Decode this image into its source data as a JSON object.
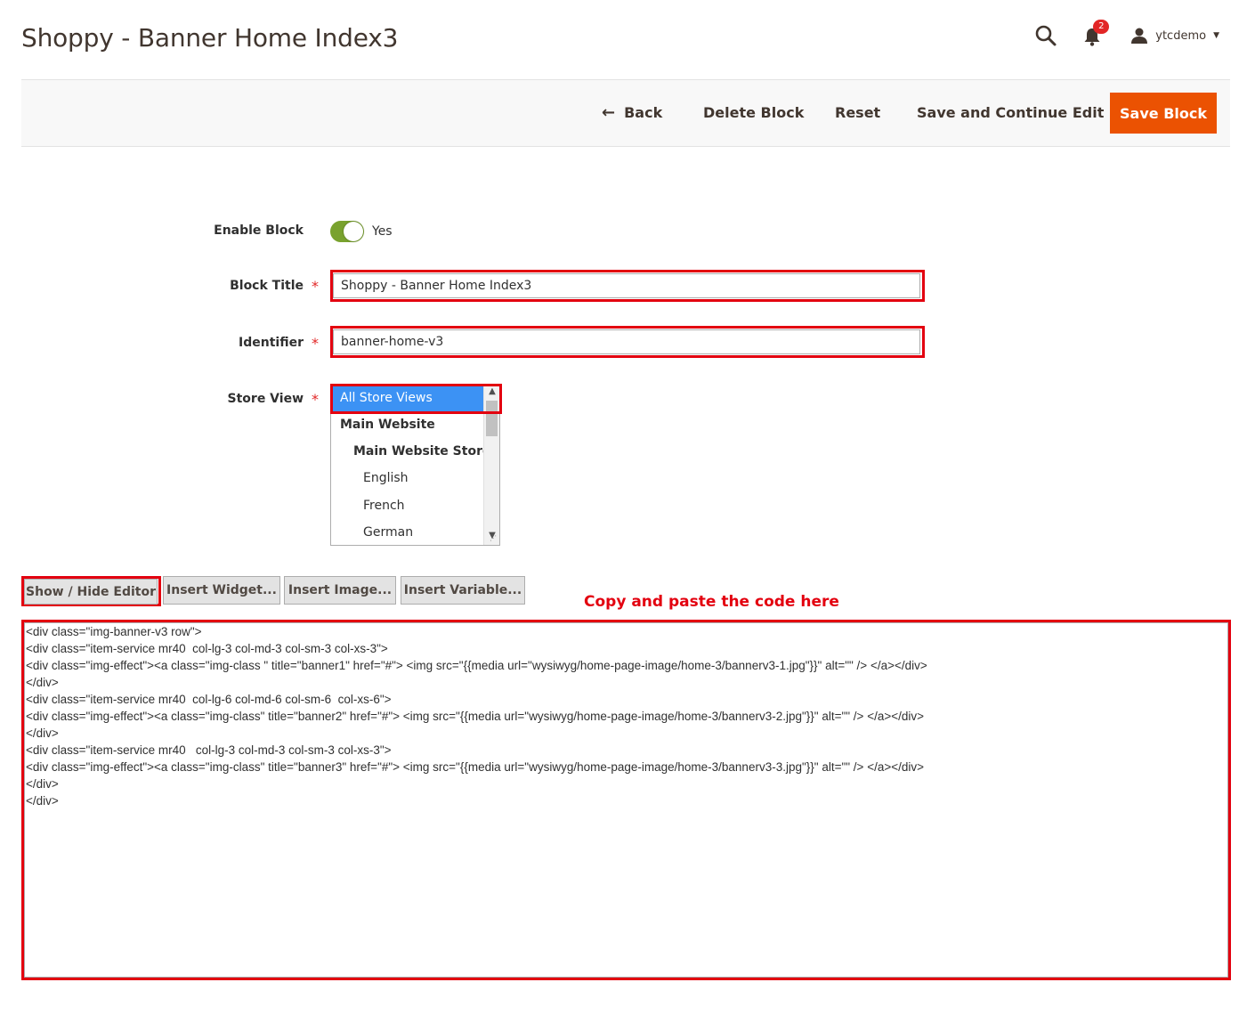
{
  "header": {
    "title": "Shoppy - Banner Home Index3",
    "notification_count": "2",
    "username": "ytcdemo"
  },
  "actions": {
    "back": "Back",
    "delete": "Delete Block",
    "reset": "Reset",
    "save_continue": "Save and Continue Edit",
    "save": "Save Block"
  },
  "form": {
    "enable_label": "Enable Block",
    "enable_value": "Yes",
    "title_label": "Block Title",
    "title_value": "Shoppy - Banner Home Index3",
    "identifier_label": "Identifier",
    "identifier_value": "banner-home-v3",
    "store_label": "Store View",
    "required_mark": "*",
    "store_options": [
      {
        "label": "All Store Views",
        "selected": true
      },
      {
        "label": "Main Website",
        "group": true
      },
      {
        "label": "Main Website Store",
        "group": true
      },
      {
        "label": "English"
      },
      {
        "label": "French"
      },
      {
        "label": "German"
      }
    ]
  },
  "editor": {
    "show_hide": "Show / Hide Editor",
    "insert_widget": "Insert Widget...",
    "insert_image": "Insert Image...",
    "insert_variable": "Insert Variable...",
    "annotation": "Copy and paste the code here",
    "content": "<div class=\"img-banner-v3 row\">\n<div class=\"item-service mr40  col-lg-3 col-md-3 col-sm-3 col-xs-3\">\n<div class=\"img-effect\"><a class=\"img-class \" title=\"banner1\" href=\"#\"> <img src=\"{{media url=\"wysiwyg/home-page-image/home-3/bannerv3-1.jpg\"}}\" alt=\"\" /> </a></div>\n</div>\n<div class=\"item-service mr40  col-lg-6 col-md-6 col-sm-6  col-xs-6\">\n<div class=\"img-effect\"><a class=\"img-class\" title=\"banner2\" href=\"#\"> <img src=\"{{media url=\"wysiwyg/home-page-image/home-3/bannerv3-2.jpg\"}}\" alt=\"\" /> </a></div>\n</div>\n<div class=\"item-service mr40   col-lg-3 col-md-3 col-sm-3 col-xs-3\">\n<div class=\"img-effect\"><a class=\"img-class\" title=\"banner3\" href=\"#\"> <img src=\"{{media url=\"wysiwyg/home-page-image/home-3/bannerv3-3.jpg\"}}\" alt=\"\" /> </a></div>\n</div>\n</div>"
  },
  "colors": {
    "accent": "#eb5202",
    "highlight": "#e3000f",
    "toggle_on": "#79a22e",
    "selection": "#3c92f4"
  }
}
